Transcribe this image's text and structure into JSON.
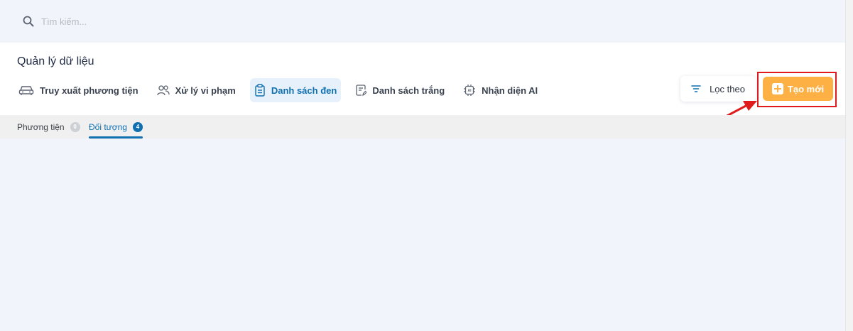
{
  "search": {
    "placeholder": "Tìm kiếm..."
  },
  "page_title": "Quản lý dữ liệu",
  "tabs": [
    {
      "label": "Truy xuất phương tiện",
      "icon": "car-icon",
      "active": false
    },
    {
      "label": "Xử lý vi phạm",
      "icon": "users-icon",
      "active": false
    },
    {
      "label": "Danh sách đen",
      "icon": "clipboard-icon",
      "active": true
    },
    {
      "label": "Danh sách trắng",
      "icon": "edit-list-icon",
      "active": false
    },
    {
      "label": "Nhận diện AI",
      "icon": "ai-chip-icon",
      "active": false
    }
  ],
  "actions": {
    "filter_label": "Lọc theo",
    "create_label": "Tạo mới"
  },
  "subtabs": [
    {
      "label": "Phương tiện",
      "count": "0",
      "active": false
    },
    {
      "label": "Đối tượng",
      "count": "4",
      "active": true
    }
  ],
  "colors": {
    "accent": "#0f6fb0",
    "create_button": "#fdb044",
    "highlight": "#e01b1b",
    "background": "#f1f4fb"
  }
}
